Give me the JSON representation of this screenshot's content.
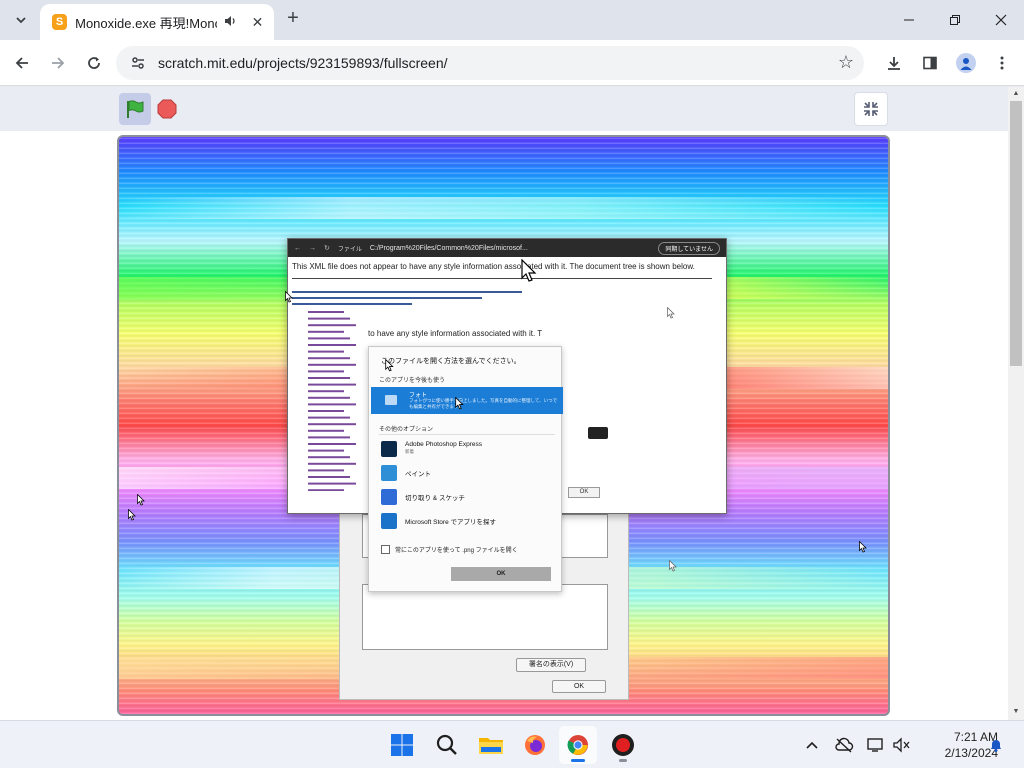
{
  "browser": {
    "tab": {
      "favicon_glyph": "S",
      "title": "Monoxide.exe 再現!Monox",
      "audio_icon": "speaker-icon",
      "close_glyph": "✕"
    },
    "new_tab_glyph": "+",
    "window_controls": {
      "minimize": "—",
      "restore": "❐",
      "close": "✕"
    },
    "url": "scratch.mit.edu/projects/923159893/fullscreen/"
  },
  "scratch": {
    "green_flag_icon": "green-flag-icon",
    "stop_icon": "stop-icon",
    "fullscreen_exit_icon": "exit-fullscreen-icon"
  },
  "stage": {
    "xml_window": {
      "address": "C:/Program%20Files/Common%20Files/microsof...",
      "file_label": "ファイル",
      "sync_label": "同期していません",
      "notice": "This XML file does not appear to have any style information associated with it. The document tree is shown below.",
      "notice_repeat": "to have any style information associated with it. T",
      "ok_label": "OK"
    },
    "open_with_dialog": {
      "title": "このファイルを開く方法を選んでください。",
      "keep_using": "このアプリを今後も使う",
      "selected_app": {
        "name": "フォト",
        "desc": "フォトがつに使い勝手が向上しました。写真を自動的に整理して、いつでも編集と共有ができます。"
      },
      "other_options": "その他のオプション",
      "apps": [
        {
          "name": "Adobe Photoshop Express",
          "desc": "新着",
          "color": "#0b2a4a"
        },
        {
          "name": "ペイント",
          "desc": "",
          "color": "#2f8fd6"
        },
        {
          "name": "切り取り & スケッチ",
          "desc": "",
          "color": "#2e6bd6"
        },
        {
          "name": "Microsoft Store でアプリを探す",
          "desc": "",
          "color": "#1a73c8"
        }
      ],
      "always_use": "常にこのアプリを使って .png ファイルを開く",
      "ok_label": "OK"
    },
    "properties_window": {
      "sig_button": "署名の表示(V)",
      "ok_label": "OK"
    }
  },
  "taskbar": {
    "apps": [
      "windows-start-icon",
      "search-icon",
      "file-explorer-icon",
      "firefox-icon",
      "chrome-icon",
      "obs-icon"
    ],
    "tray": [
      "chevron-up-icon",
      "cloud-offline-icon",
      "display-icon",
      "speaker-muted-icon",
      "notification-bell-icon"
    ],
    "time": "7:21 AM",
    "date": "2/13/2024"
  }
}
